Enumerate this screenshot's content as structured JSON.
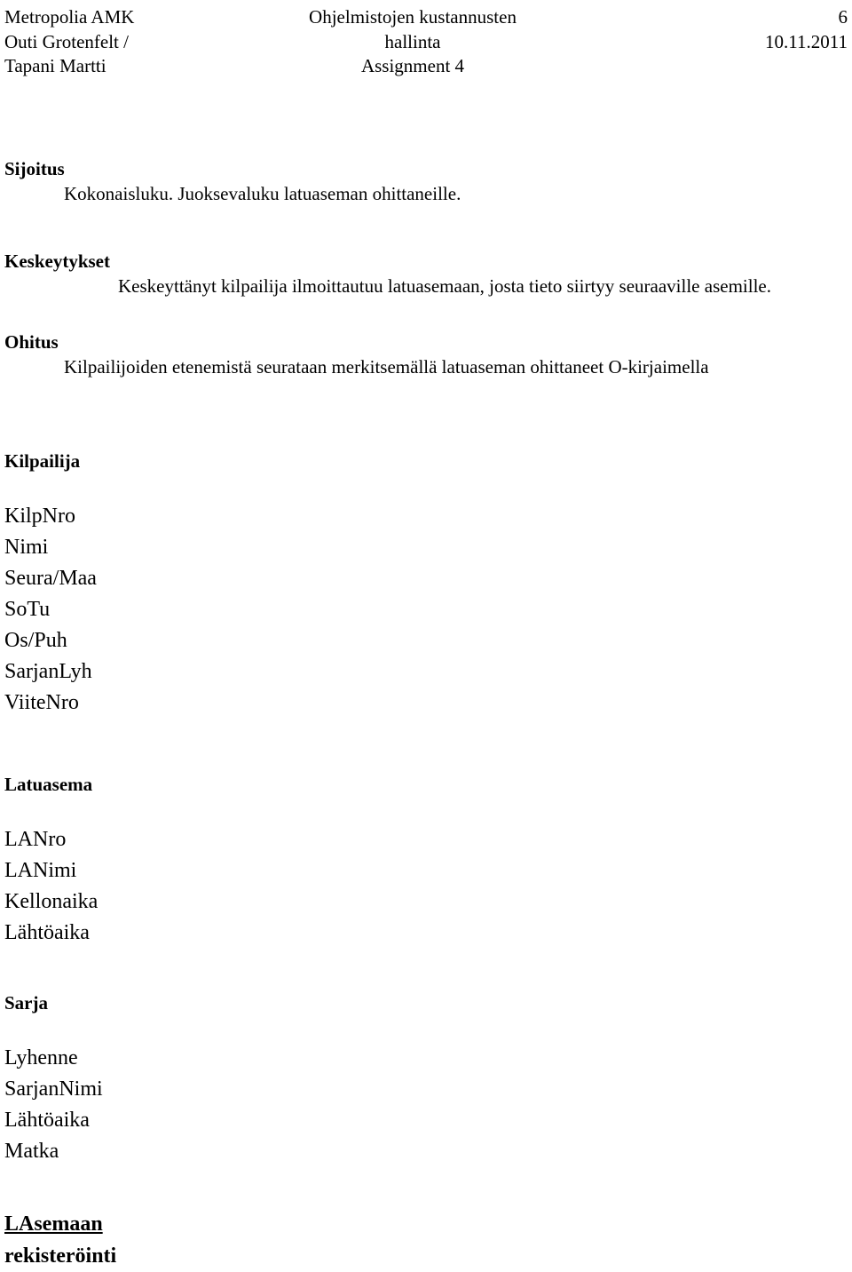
{
  "header": {
    "left_lines": [
      "Metropolia AMK",
      "Outi Grotenfelt /",
      "Tapani Martti"
    ],
    "center_lines": [
      "Ohjelmistojen kustannusten",
      "hallinta",
      "Assignment 4"
    ],
    "page_number": "6",
    "date": "10.11.2011"
  },
  "sections": [
    {
      "heading": "Sijoitus",
      "body": "Kokonaisluku. Juoksevaluku latuaseman ohittaneille."
    },
    {
      "heading": "Keskeytykset",
      "body": "Keskeyttänyt kilpailija ilmoittautuu latuasemaan, josta tieto siirtyy seuraaville asemille."
    },
    {
      "heading": "Ohitus",
      "body": "Kilpailijoiden etenemistä seurataan merkitsemällä latuaseman ohittaneet O-kirjaimella"
    }
  ],
  "entities": [
    {
      "title": "Kilpailija",
      "fields": [
        "KilpNro",
        "Nimi",
        "Seura/Maa",
        "SoTu",
        "Os/Puh",
        "SarjanLyh",
        "ViiteNro"
      ]
    },
    {
      "title": "Latuasema",
      "fields": [
        "LANro",
        "LANimi",
        "Kellonaika",
        "Lähtöaika"
      ]
    },
    {
      "title": "Sarja",
      "fields": [
        "Lyhenne",
        "SarjanNimi",
        "Lähtöaika",
        "Matka"
      ]
    }
  ],
  "tail": {
    "line1": "LAsemaan",
    "line2": "rekisteröinti"
  }
}
